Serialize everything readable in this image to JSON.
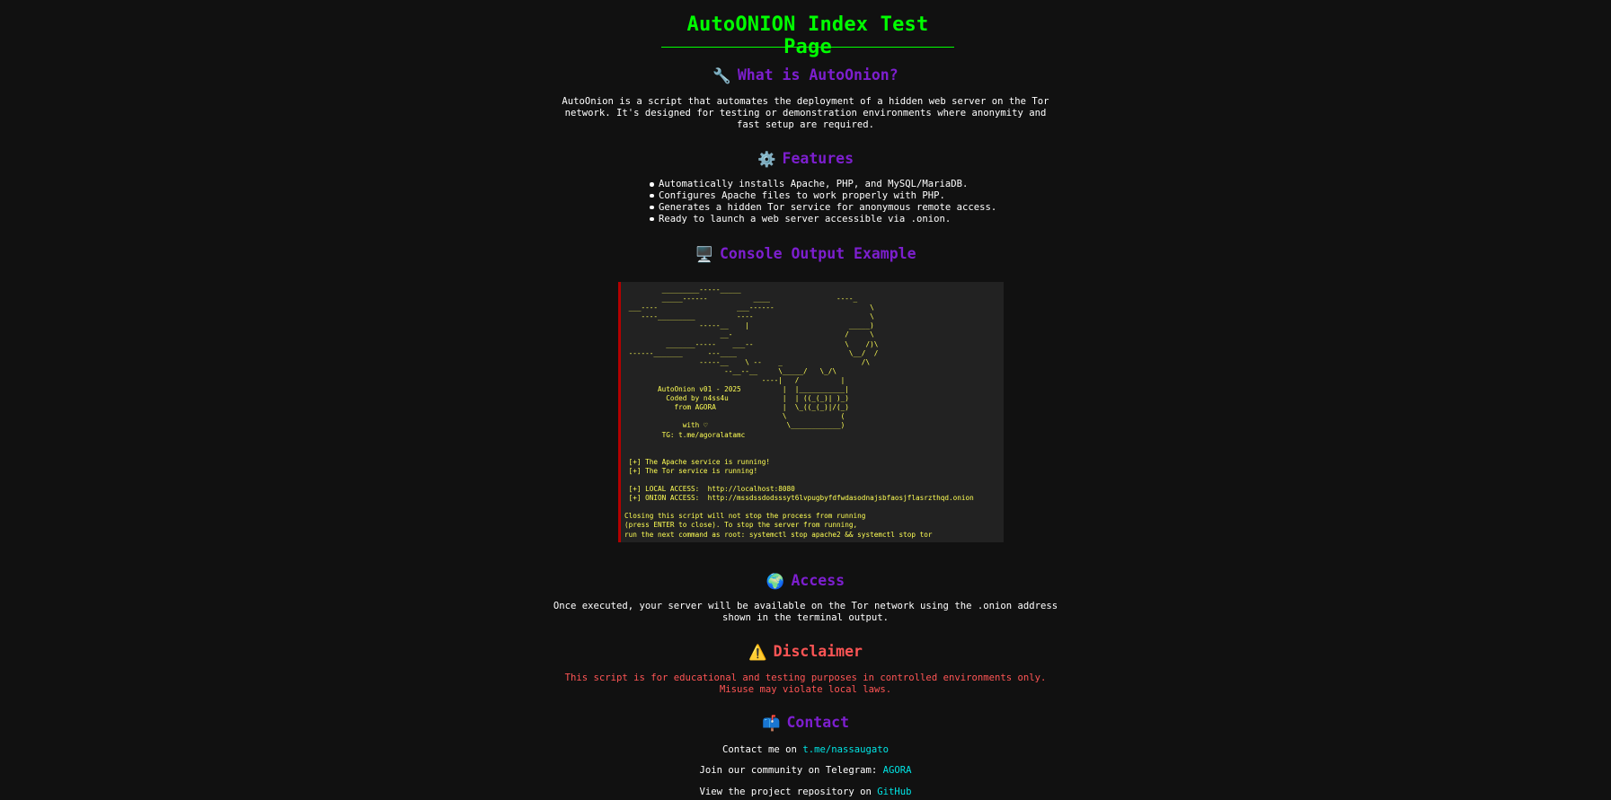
{
  "page_title": "AutoONION Index Test Page",
  "what": {
    "icon": "🔧",
    "heading": "What is AutoOnion?",
    "text": "AutoOnion is a script that automates the deployment of a hidden web server on the Tor\nnetwork. It's designed for testing or demonstration environments where anonymity and\nfast setup are required."
  },
  "features": {
    "icon": "⚙️",
    "heading": "Features",
    "items": [
      "Automatically installs Apache, PHP, and MySQL/MariaDB.",
      "Configures Apache files to work properly with PHP.",
      "Generates a hidden Tor service for anonymous remote access.",
      "Ready to launch a web server accessible via .onion."
    ]
  },
  "console": {
    "icon": "🖥️",
    "heading": "Console Output Example",
    "output": "         _________-----_____\n         _____------           ____                ----_\n ___----                   ___------                       \\\n    ----_________          ----                            \\\n                  -----__    |                        _____)\n                       __-                           /     \\\n          _______-----    ___--                      \\    /)\\\n ------_______      ---____                           \\__/  /\n                  -----__    \\ --    _                   /\\\n                        --__--__     \\_____/   \\_/\\\n                                 ----|   /          |\n        AutoOnion v01 - 2025          |  |___________|\n          Coded by n4ss4u             |  | ((_(_)| )_)\n            from AGORA                |  \\_((_(_)|/(_)\n                                      \\             (\n              with ♡                   \\____________)\n         TG: t.me/agoralatamc\n\n\n [+] The Apache service is running!\n [+] The Tor service is running!\n\n [+] LOCAL ACCESS:  http://localhost:8080\n [+] ONION ACCESS:  http://mssdssdodsssyt6lvpugbyfdfwdasodnajsbfaosjflasrzthqd.onion\n\nClosing this script will not stop the process from running\n(press ENTER to close). To stop the server from running,\nrun the next command as root: systemctl stop apache2 && systemctl stop tor"
  },
  "access": {
    "icon": "🌍",
    "heading": "Access",
    "text": "Once executed, your server will be available on the Tor network using the .onion address\nshown in the terminal output."
  },
  "disclaimer": {
    "icon": "⚠️",
    "heading": "Disclaimer",
    "text": "This script is for educational and testing purposes in controlled environments only.\nMisuse may violate local laws."
  },
  "contact": {
    "icon": "📫",
    "heading": "Contact",
    "line1_prefix": "Contact me on ",
    "line1_link": "t.me/nassaugato",
    "line2_prefix": "Join our community on Telegram: ",
    "line2_link": "AGORA",
    "line3_prefix": "View the project repository on ",
    "line3_link": "GitHub"
  },
  "colors": {
    "background": "#111111",
    "title_green": "#00ff00",
    "heading_purple": "#7d1fcf",
    "warning_red": "#ff5555",
    "console_text": "#ffff55",
    "link_cyan": "#00e5e5"
  }
}
